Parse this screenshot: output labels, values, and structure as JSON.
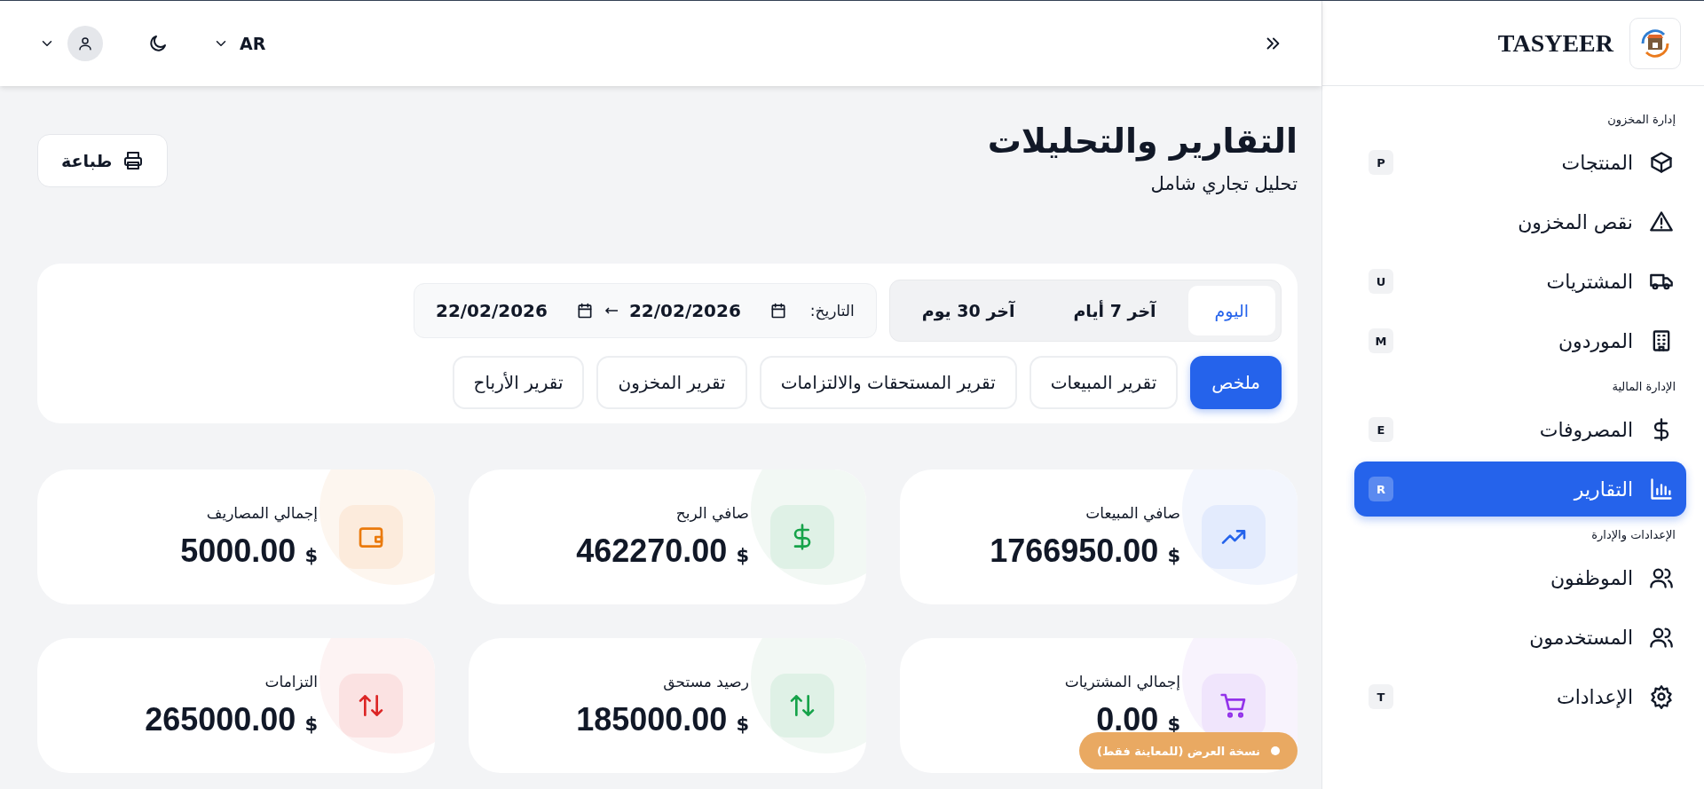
{
  "sidebar": {
    "brand": "TASYEER",
    "sections": [
      {
        "title": "إدارة المخزون",
        "items": [
          {
            "label": "المنتجات",
            "kind": "box",
            "shortcut": "P",
            "selected": false
          },
          {
            "label": "نقص المخزون",
            "kind": "warning",
            "selected": false
          },
          {
            "label": "المشتريات",
            "kind": "truck",
            "shortcut": "U",
            "selected": false
          },
          {
            "label": "الموردون",
            "kind": "building",
            "shortcut": "M",
            "selected": false
          }
        ]
      },
      {
        "title": "الإدارة المالية",
        "items": [
          {
            "label": "المصروفات",
            "kind": "dollar",
            "shortcut": "E",
            "selected": false
          },
          {
            "label": "التقارير",
            "kind": "chart",
            "shortcut": "R",
            "selected": true
          }
        ]
      },
      {
        "title": "الإعدادات والإدارة",
        "items": [
          {
            "label": "الموظفون",
            "kind": "people",
            "selected": false
          },
          {
            "label": "المستخدمون",
            "kind": "people",
            "selected": false
          },
          {
            "label": "الإعدادات",
            "kind": "gear",
            "shortcut": "T",
            "selected": false
          }
        ]
      }
    ]
  },
  "topbar": {
    "language": "AR"
  },
  "page": {
    "title": "التقارير والتحليلات",
    "subtitle": "تحليل تجاري شامل",
    "print_button": "طباعة"
  },
  "filters": {
    "periods": [
      {
        "label": "اليوم",
        "selected": true
      },
      {
        "label": "آخر 7 أيام",
        "selected": false
      },
      {
        "label": "آخر 30 يوم",
        "selected": false
      }
    ],
    "date_label": "التاريخ:",
    "date_from": "22/02/2026",
    "date_to": "22/02/2026"
  },
  "report_tabs": [
    {
      "label": "ملخص",
      "selected": true
    },
    {
      "label": "تقرير المبيعات",
      "selected": false
    },
    {
      "label": "تقرير المستحقات والالتزامات",
      "selected": false
    },
    {
      "label": "تقرير المخزون",
      "selected": false
    },
    {
      "label": "تقرير الأرباح",
      "selected": false
    }
  ],
  "stats": [
    {
      "label": "صافي المبيعات",
      "value": "1766950.00",
      "currency": "$",
      "kind": "sales"
    },
    {
      "label": "صافي الربح",
      "value": "462270.00",
      "currency": "$",
      "kind": "profit"
    },
    {
      "label": "إجمالي المصاريف",
      "value": "5000.00",
      "currency": "$",
      "kind": "expenses"
    },
    {
      "label": "إجمالي المشتريات",
      "value": "0.00",
      "currency": "$",
      "kind": "purchases"
    },
    {
      "label": "رصيد مستحق",
      "value": "185000.00",
      "currency": "$",
      "kind": "receivable"
    },
    {
      "label": "التزامات",
      "value": "265000.00",
      "currency": "$",
      "kind": "liabilities"
    }
  ],
  "demo_badge": {
    "label": "نسخة العرض (للمعاينة فقط)"
  }
}
